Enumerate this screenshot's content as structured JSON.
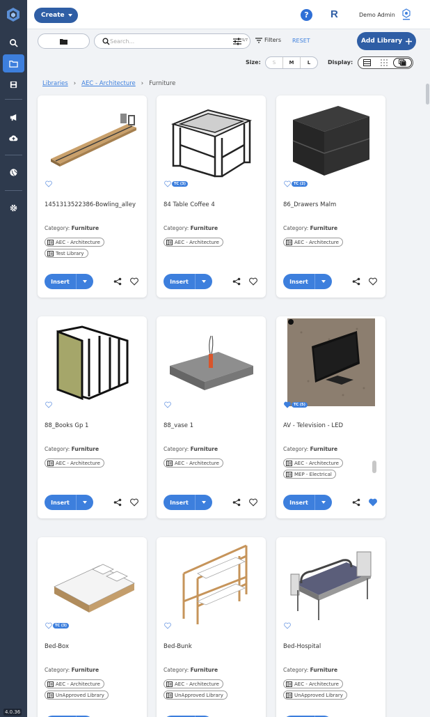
{
  "app": {
    "version": "4.0.36",
    "user_name": "Demo Admin",
    "create_label": "Create",
    "help_glyph": "?",
    "r_glyph": "R"
  },
  "toolbar": {
    "search_placeholder": "Search...",
    "shortcut_count": "5/7",
    "filters_label": "Filters",
    "reset_label": "RESET",
    "add_library_label": "Add Library",
    "size_label": "Size:",
    "size_options": [
      "S",
      "M",
      "L"
    ],
    "size_selected": "M",
    "display_label": "Display:"
  },
  "breadcrumb": {
    "items": [
      "Libraries",
      "AEC - Architecture",
      "Furniture"
    ],
    "separator": "›"
  },
  "labels": {
    "category_prefix": "Category:",
    "insert": "Insert"
  },
  "colors": {
    "sidebar_bg": "#2e3a4d",
    "primary": "#2f5ea5",
    "accent": "#3d7fdd"
  },
  "cards": [
    {
      "title": "1451313522386-Bowling_alley",
      "category": "Furniture",
      "tags": [
        "AEC - Architecture",
        "Test Library"
      ],
      "tc": "",
      "favorited": false
    },
    {
      "title": "84 Table Coffee 4",
      "category": "Furniture",
      "tags": [
        "AEC - Architecture"
      ],
      "tc": "TC (3)",
      "favorited": false
    },
    {
      "title": "86_Drawers Malm",
      "category": "Furniture",
      "tags": [
        "AEC - Architecture"
      ],
      "tc": "TC (2)",
      "favorited": false
    },
    {
      "title": "88_Books Gp 1",
      "category": "Furniture",
      "tags": [
        "AEC - Architecture"
      ],
      "tc": "",
      "favorited": false
    },
    {
      "title": "88_vase 1",
      "category": "Furniture",
      "tags": [
        "AEC - Architecture"
      ],
      "tc": "",
      "favorited": false
    },
    {
      "title": "AV - Television - LED",
      "category": "Furniture",
      "tags": [
        "AEC - Architecture",
        "MEP - Electrical"
      ],
      "tc": "TC (5)",
      "favorited": true
    },
    {
      "title": "Bed-Box",
      "category": "Furniture",
      "tags": [
        "AEC - Architecture",
        "UnApproved Library"
      ],
      "tc": "TC (3)",
      "favorited": false
    },
    {
      "title": "Bed-Bunk",
      "category": "Furniture",
      "tags": [
        "AEC - Architecture",
        "UnApproved Library"
      ],
      "tc": "",
      "favorited": false
    },
    {
      "title": "Bed-Hospital",
      "category": "Furniture",
      "tags": [
        "AEC - Architecture",
        "UnApproved Library"
      ],
      "tc": "",
      "favorited": false
    }
  ]
}
